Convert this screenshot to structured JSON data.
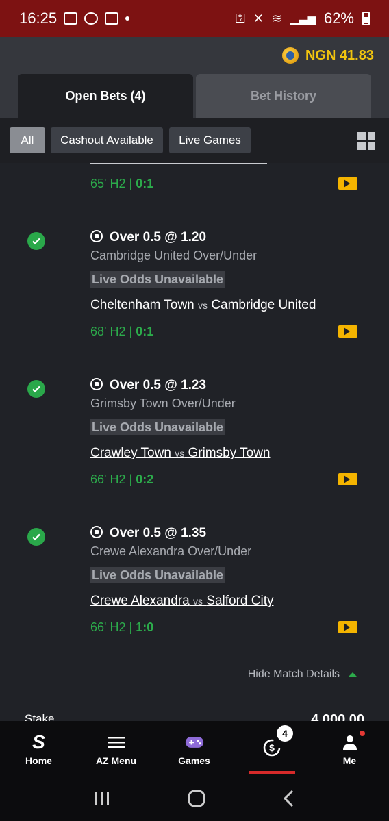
{
  "status_bar": {
    "time": "16:25",
    "battery": "62%"
  },
  "wallet": {
    "balance": "NGN 41.83"
  },
  "tabs": [
    {
      "label": "Open Bets (4)",
      "active": true
    },
    {
      "label": "Bet History",
      "active": false
    }
  ],
  "filters": [
    {
      "label": "All",
      "selected": true
    },
    {
      "label": "Cashout Available",
      "selected": false
    },
    {
      "label": "Live Games",
      "selected": false
    }
  ],
  "partial_bet": {
    "minute": "65' H2",
    "separator": "|",
    "score": "0:1"
  },
  "bets": [
    {
      "selection": "Over 0.5 @ 1.20",
      "market": "Cambridge United Over/Under",
      "odds_status": "Live Odds Unavailable",
      "home": "Cheltenham Town",
      "vs": "vs",
      "away": "Cambridge United",
      "minute": "68' H2",
      "separator": "|",
      "score": "0:1"
    },
    {
      "selection": "Over 0.5 @ 1.23",
      "market": "Grimsby Town Over/Under",
      "odds_status": "Live Odds Unavailable",
      "home": "Crawley Town",
      "vs": "vs",
      "away": "Grimsby Town",
      "minute": "66' H2",
      "separator": "|",
      "score": "0:2"
    },
    {
      "selection": "Over 0.5 @ 1.35",
      "market": "Crewe Alexandra Over/Under",
      "odds_status": "Live Odds Unavailable",
      "home": "Crewe Alexandra",
      "vs": "vs",
      "away": "Salford City",
      "minute": "66' H2",
      "separator": "|",
      "score": "1:0"
    }
  ],
  "hide_details": "Hide Match Details",
  "stake": {
    "label": "Stake",
    "amount": "4,000.00"
  },
  "bottom_nav": [
    {
      "label": "Home"
    },
    {
      "label": "AZ Menu"
    },
    {
      "label": "Games"
    },
    {
      "label": "",
      "badge": "4"
    },
    {
      "label": "Me"
    }
  ]
}
